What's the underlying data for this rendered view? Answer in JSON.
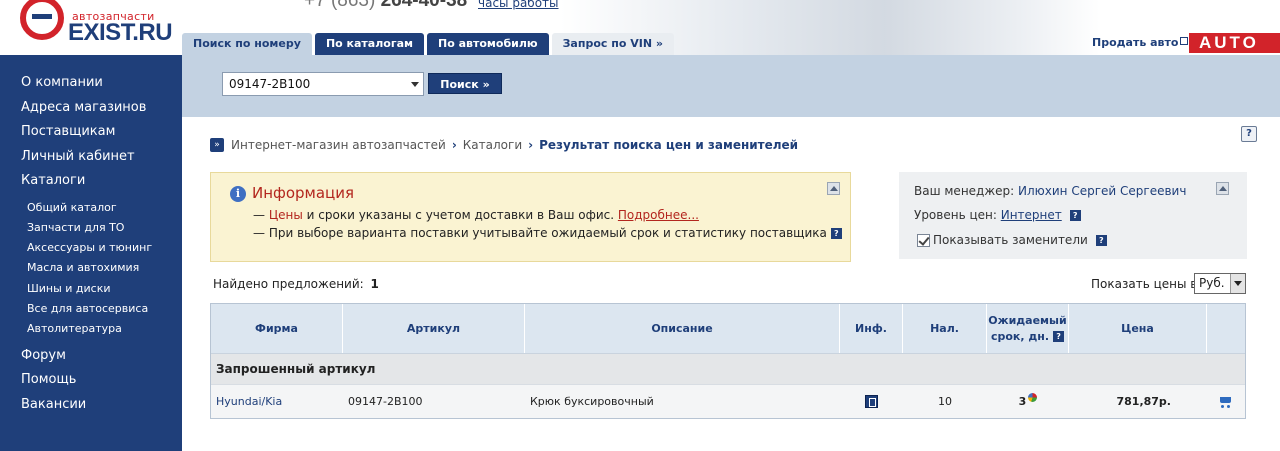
{
  "header": {
    "logo_small": "автозапчасти",
    "logo_big": "EXIST.RU",
    "phone_code": "+7 (863)",
    "phone_number": "264-40-38",
    "hours_link": "часы работы",
    "sell_auto": "Продать авто",
    "auto_logo": "AUTO",
    "tabs": [
      {
        "label": "Поиск по номеру"
      },
      {
        "label": "По каталогам"
      },
      {
        "label": "По автомобилю"
      },
      {
        "label": "Запрос по VIN »"
      }
    ]
  },
  "sidebar": {
    "items": [
      {
        "label": "О компании"
      },
      {
        "label": "Адреса магазинов"
      },
      {
        "label": "Поставщикам"
      },
      {
        "label": "Личный кабинет"
      },
      {
        "label": "Каталоги"
      }
    ],
    "sub_items": [
      {
        "label": "Общий каталог"
      },
      {
        "label": "Запчасти для ТО"
      },
      {
        "label": "Аксессуары и тюнинг"
      },
      {
        "label": "Масла и автохимия"
      },
      {
        "label": "Шины и диски"
      },
      {
        "label": "Все для автосервиса"
      },
      {
        "label": "Автолитература"
      }
    ],
    "bottom_items": [
      {
        "label": "Форум"
      },
      {
        "label": "Помощь"
      },
      {
        "label": "Вакансии"
      }
    ]
  },
  "search": {
    "value": "09147-2B100",
    "button": "Поиск »"
  },
  "breadcrumb": {
    "items": [
      "Интернет-магазин автозапчастей",
      "Каталоги"
    ],
    "current": "Результат поиска цен и заменителей"
  },
  "info": {
    "title": "Информация",
    "line1_dash": "— ",
    "line1_red": "Цены",
    "line1_text": " и сроки указаны с учетом доставки в Ваш офис. ",
    "line1_link": "Подробнее...",
    "line2": "— При выборе варианта поставки учитывайте ожидаемый срок и статистику поставщика"
  },
  "manager": {
    "manager_label": "Ваш менеджер: ",
    "manager_name": "Илюхин Сергей Сергеевич",
    "level_label": "Уровень цен: ",
    "level_value": "Интернет",
    "show_replacements": "Показывать заменители"
  },
  "results": {
    "found_label": "Найдено предложений:",
    "found_count": "1",
    "currency_label": "Показать цены в",
    "currency_value": "Руб.",
    "columns": [
      "Фирма",
      "Артикул",
      "Описание",
      "Инф.",
      "Нал.",
      "Ожидаемый срок, дн.",
      "Цена",
      ""
    ],
    "expected_line1": "Ожидаемый",
    "expected_line2": "срок, дн.",
    "group_label": "Запрошенный артикул",
    "rows": [
      {
        "brand": "Hyundai/Kia",
        "article": "09147-2B100",
        "description": "Крюк буксировочный",
        "qty": "10",
        "days": "3",
        "price": "781,87р."
      }
    ]
  },
  "icons": {
    "help": "?",
    "info": "i"
  },
  "colors": {
    "brand_blue": "#1f3f7a",
    "brand_red": "#d2232a",
    "info_bg": "#faf3d2"
  }
}
